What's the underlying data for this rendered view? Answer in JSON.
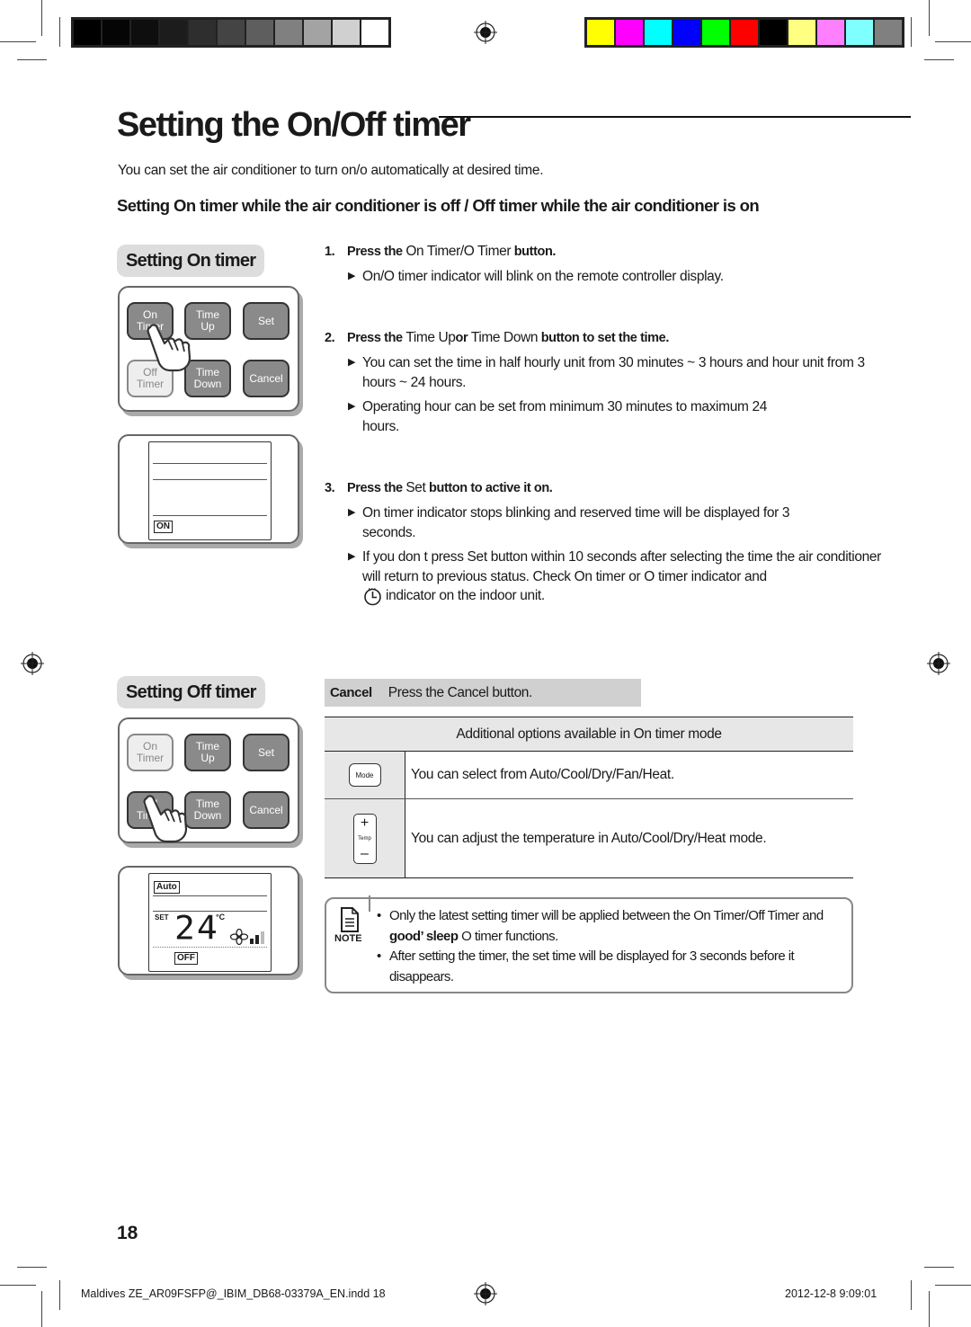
{
  "color_bars": {
    "grayscale": [
      "#000000",
      "#050505",
      "#0e0e0e",
      "#1c1c1c",
      "#2e2e2e",
      "#444444",
      "#5e5e5e",
      "#808080",
      "#a3a3a3",
      "#d0d0d0",
      "#ffffff"
    ],
    "process": [
      "#ffff00",
      "#ff00ff",
      "#00ffff",
      "#0000ff",
      "#00ff00",
      "#ff0000",
      "#000000",
      "#ffff80",
      "#ff80ff",
      "#80ffff",
      "#808080"
    ]
  },
  "page": {
    "title": "Setting the On/Off timer",
    "intro": "You can set the air conditioner to turn on/o  automatically at desired time.",
    "subhead": "Setting On timer while the air conditioner is off / Off timer while the air conditioner is on"
  },
  "on_timer": {
    "label": "Setting On timer",
    "remote_buttons": [
      {
        "line1": "On",
        "line2": "Timer",
        "state": "pressed"
      },
      {
        "line1": "Time",
        "line2": "Up",
        "state": "normal"
      },
      {
        "line1": "Set",
        "line2": "",
        "state": "normal"
      },
      {
        "line1": "Off",
        "line2": "Timer",
        "state": "dimmed"
      },
      {
        "line1": "Time",
        "line2": "Down",
        "state": "normal"
      },
      {
        "line1": "Cancel",
        "line2": "",
        "state": "normal"
      }
    ],
    "display_tag": "ON"
  },
  "steps": [
    {
      "num": "1.",
      "pre": "Press the ",
      "key": "On Timer/O  Timer",
      "post": " button.",
      "bullets": [
        "On/O  timer indicator will blink on the remote controller display."
      ]
    },
    {
      "num": "2.",
      "pre": "Press the ",
      "key": "Time Up",
      "mid": "or ",
      "key2": "Time Down",
      "post": " button to set the time.",
      "bullets": [
        "You can set the time in half hourly unit from 30 minutes ~ 3 hours and hour unit from 3 hours ~ 24 hours.",
        "Operating hour can be set from minimum 30 minutes to maximum 24 hours."
      ]
    },
    {
      "num": "3.",
      "pre": "Press the ",
      "key": "Set",
      "post": " button to active it on.",
      "bullets": [
        "On timer indicator stops blinking and reserved time will be displayed for 3 seconds.",
        "If you don t press Set button within 10 seconds after selecting the time the air conditioner will return to previous status. Check On timer or O  timer indicator and",
        "indicator on the indoor unit."
      ]
    }
  ],
  "off_timer": {
    "label": "Setting Off timer",
    "remote_buttons": [
      {
        "line1": "On",
        "line2": "Timer",
        "state": "dimmed"
      },
      {
        "line1": "Time",
        "line2": "Up",
        "state": "normal"
      },
      {
        "line1": "Set",
        "line2": "",
        "state": "normal"
      },
      {
        "line1": "Off",
        "line2": "Timer",
        "state": "pressed"
      },
      {
        "line1": "Time",
        "line2": "Down",
        "state": "normal"
      },
      {
        "line1": "Cancel",
        "line2": "",
        "state": "normal"
      }
    ],
    "display": {
      "mode_tag": "Auto",
      "set_label": "SET",
      "temperature": "24",
      "unit": "°C",
      "timer_tag": "OFF",
      "fan_level_bars_on": 2,
      "fan_level_bars_total": 3
    }
  },
  "cancel": {
    "key": "Cancel",
    "text": "Press the Cancel button."
  },
  "options": {
    "header": "Additional options available in On timer mode",
    "rows": [
      {
        "icon": "mode-button-icon",
        "icon_label": "Mode",
        "text": "You can select from Auto/Cool/Dry/Fan/Heat."
      },
      {
        "icon": "temp-button-icon",
        "icon_label": "Temp",
        "plus": "+",
        "minus": "–",
        "text": "You can adjust the temperature in Auto/Cool/Dry/Heat mode."
      }
    ]
  },
  "note": {
    "label": "NOTE",
    "items": [
      {
        "pre": "Only the latest setting timer will be applied between the On Timer/Off Timer and ",
        "bold": "good’ sleep",
        "post": " O  timer functions."
      },
      {
        "pre": "After setting the timer, the set time will be displayed for 3 seconds before it disappears.",
        "bold": "",
        "post": ""
      }
    ]
  },
  "footer": {
    "page_number": "18",
    "slug": "Maldives ZE_AR09FSFP@_IBIM_DB68-03379A_EN.indd   18",
    "timestamp": "2012-12-8   9:09:01"
  }
}
